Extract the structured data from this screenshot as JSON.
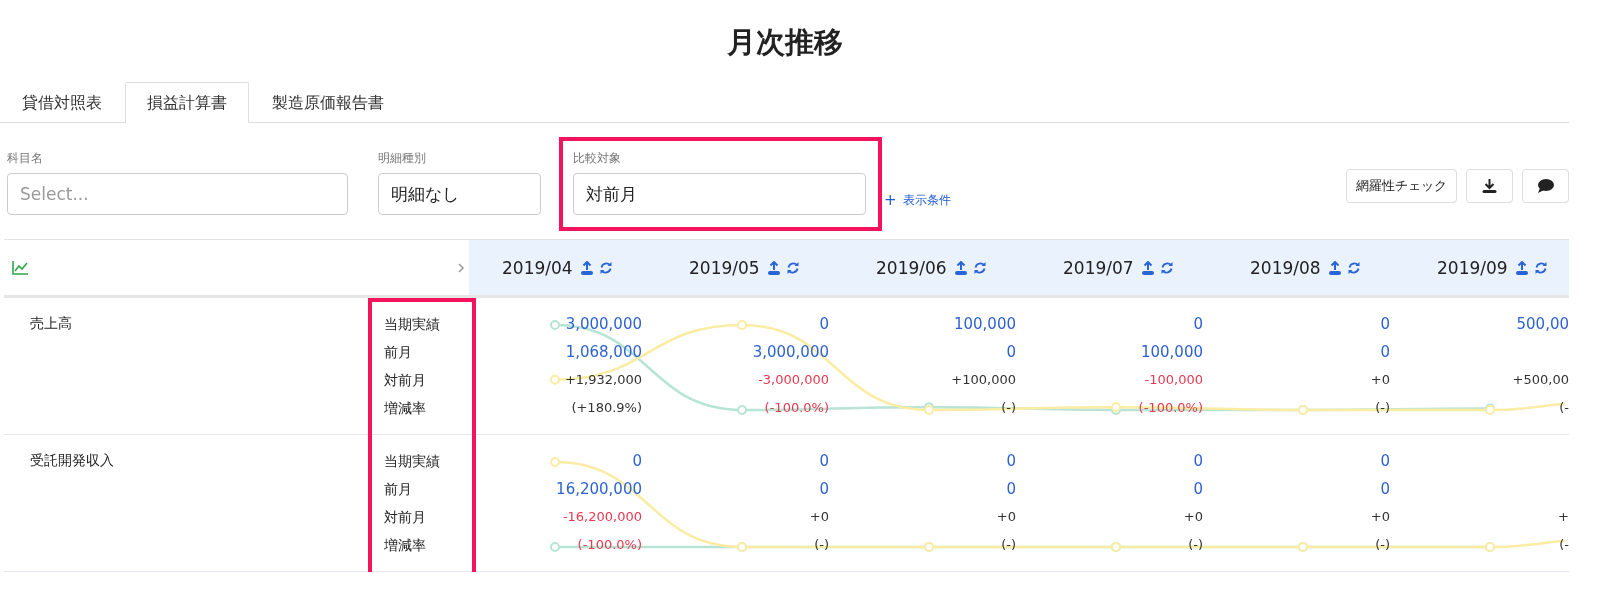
{
  "title": "月次推移",
  "tabs": [
    {
      "label": "貸借対照表",
      "selected": false
    },
    {
      "label": "損益計算書",
      "selected": true
    },
    {
      "label": "製造原価報告書",
      "selected": false
    }
  ],
  "filters": [
    {
      "label": "科目名",
      "placeholder": "Select...",
      "highlighted": false
    },
    {
      "label": "明細種別",
      "value": "明細なし",
      "highlighted": false
    },
    {
      "label": "比較対象",
      "value": "対前月",
      "highlighted": true
    }
  ],
  "add_condition": {
    "icon": "+",
    "label": "表示条件"
  },
  "check_button": "網羅性チェック",
  "table": {
    "labels_highlighted": true,
    "months": [
      "2019/04",
      "2019/05",
      "2019/06",
      "2019/07",
      "2019/08",
      "2019/09"
    ],
    "rows": [
      {
        "account": "売上高",
        "metrics": [
          {
            "label": "当期実績",
            "kind": "amount",
            "values": [
              {
                "text": "3,000,000"
              },
              {
                "text": "0"
              },
              {
                "text": "100,000"
              },
              {
                "text": "0"
              },
              {
                "text": "0"
              },
              {
                "text": "500,00"
              }
            ]
          },
          {
            "label": "前月",
            "kind": "amount",
            "values": [
              {
                "text": "1,068,000"
              },
              {
                "text": "3,000,000"
              },
              {
                "text": "0"
              },
              {
                "text": "100,000"
              },
              {
                "text": "0"
              }
            ]
          },
          {
            "label": "対前月",
            "kind": "change",
            "values": [
              {
                "text": "+1,932,000",
                "negative": false
              },
              {
                "text": "-3,000,000",
                "negative": true
              },
              {
                "text": "+100,000",
                "negative": false
              },
              {
                "text": "-100,000",
                "negative": true
              },
              {
                "text": "+0",
                "negative": false
              },
              {
                "text": "+500,00",
                "negative": false
              }
            ]
          },
          {
            "label": "増減率",
            "kind": "change",
            "values": [
              {
                "text": "(+180.9%)",
                "negative": false
              },
              {
                "text": "(-100.0%)",
                "negative": true
              },
              {
                "text": "(-)",
                "negative": false
              },
              {
                "text": "(-100.0%)",
                "negative": true
              },
              {
                "text": "(-)",
                "negative": false
              },
              {
                "text": "(-",
                "negative": false
              }
            ]
          }
        ]
      },
      {
        "account": "受託開発収入",
        "metrics": [
          {
            "label": "当期実績",
            "kind": "amount",
            "values": [
              {
                "text": "0"
              },
              {
                "text": "0"
              },
              {
                "text": "0"
              },
              {
                "text": "0"
              },
              {
                "text": "0"
              }
            ]
          },
          {
            "label": "前月",
            "kind": "amount",
            "values": [
              {
                "text": "16,200,000"
              },
              {
                "text": "0"
              },
              {
                "text": "0"
              },
              {
                "text": "0"
              },
              {
                "text": "0"
              }
            ]
          },
          {
            "label": "対前月",
            "kind": "change",
            "values": [
              {
                "text": "-16,200,000",
                "negative": true
              },
              {
                "text": "+0",
                "negative": false
              },
              {
                "text": "+0",
                "negative": false
              },
              {
                "text": "+0",
                "negative": false
              },
              {
                "text": "+0",
                "negative": false
              },
              {
                "text": "+",
                "negative": false
              }
            ]
          },
          {
            "label": "増減率",
            "kind": "change",
            "values": [
              {
                "text": "(-100.0%)",
                "negative": true
              },
              {
                "text": "(-)",
                "negative": false
              },
              {
                "text": "(-)",
                "negative": false
              },
              {
                "text": "(-)",
                "negative": false
              },
              {
                "text": "(-)",
                "negative": false
              },
              {
                "text": "(-",
                "negative": false
              }
            ]
          }
        ]
      }
    ]
  }
}
